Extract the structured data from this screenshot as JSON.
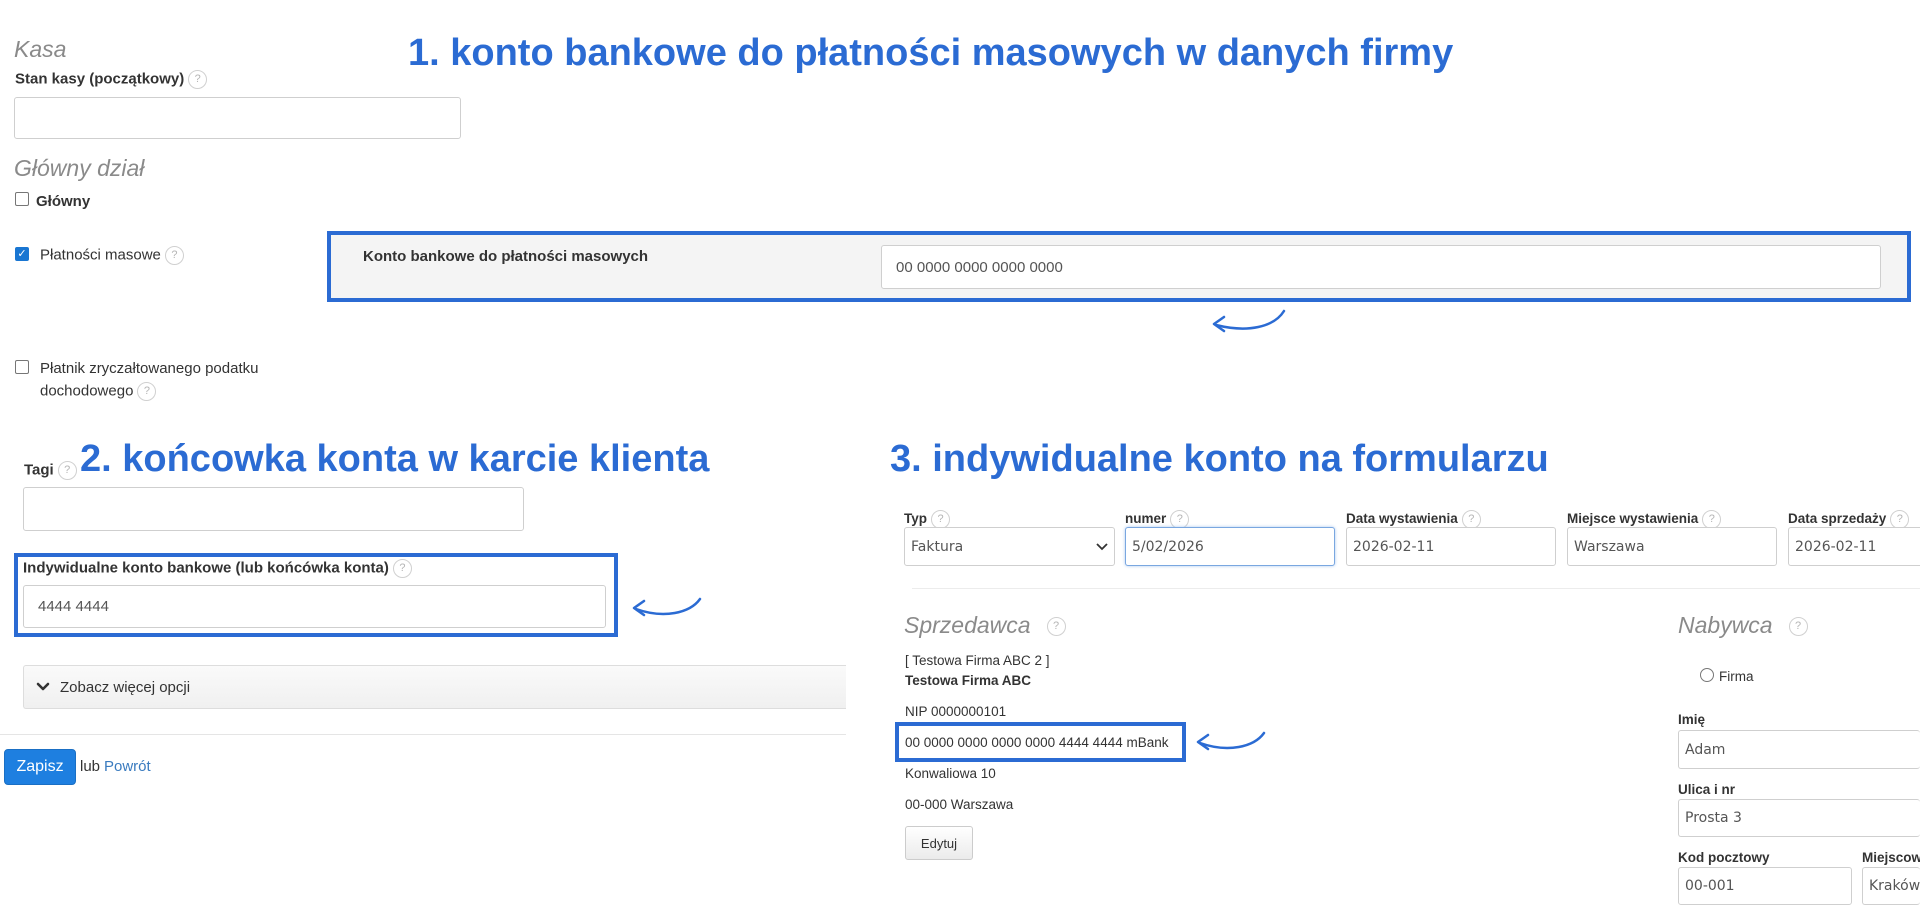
{
  "headings": {
    "h1": "1. konto bankowe do płatności masowych w danych firmy",
    "h2": "2. końcowka konta w karcie klienta",
    "h3": "3. indywidualne konto na formularzu"
  },
  "settings": {
    "kasa_title": "Kasa",
    "stan_kasy_label": "Stan kasy (początkowy)",
    "stan_kasy_value": "",
    "glowny_dzial_title": "Główny dział",
    "glowny_label": "Główny",
    "platnosci_masowe_label": "Płatności masowe",
    "konto_masowe_label": "Konto bankowe do płatności masowych",
    "konto_masowe_value": "00 0000 0000 0000 0000",
    "platnik_line1": "Płatnik zryczałtowanego podatku",
    "platnik_line2": "dochodowego",
    "help_glyph": "?"
  },
  "client": {
    "tagi_label": "Tagi",
    "tagi_value": "",
    "indywidualne_label": "Indywidualne konto bankowe (lub końcówka konta)",
    "indywidualne_value": "4444 4444",
    "more_options": "Zobacz więcej opcji",
    "save_button": "Zapisz",
    "or_text": "lub",
    "back_link": "Powrót"
  },
  "invoice": {
    "typ_label": "Typ",
    "typ_value": "Faktura",
    "numer_label": "numer",
    "numer_value": "5/02/2026",
    "data_wystawienia_label": "Data wystawienia",
    "data_wystawienia_value": "2026-02-11",
    "miejsce_label": "Miejsce wystawienia",
    "miejsce_value": "Warszawa",
    "data_sprzedazy_label": "Data sprzedaży",
    "data_sprzedazy_value": "2026-02-11",
    "sprzedawca_title": "Sprzedawca",
    "seller_short": "[ Testowa Firma ABC 2 ]",
    "seller_name": "Testowa Firma ABC",
    "seller_nip": "NIP 0000000101",
    "seller_account": "00 0000 0000 0000 0000 4444 4444 mBank",
    "seller_street": "Konwaliowa 10",
    "seller_city": "00-000 Warszawa",
    "edit_button": "Edytuj",
    "nabywca_title": "Nabywca",
    "firma_radio": "Firma",
    "imie_label": "Imię",
    "imie_value": "Adam",
    "ulica_label": "Ulica i nr",
    "ulica_value": "Prosta 3",
    "kod_label": "Kod pocztowy",
    "kod_value": "00-001",
    "miejscowosc_label": "Miejscow",
    "miejscowosc_value": "Kraków"
  },
  "colors": {
    "accent": "#2b6bd3",
    "primary_button": "#1e7fe0"
  },
  "icons": {
    "arrow": "curved-arrow-icon",
    "chevron": "chevron-down-icon",
    "check": "checkmark-icon"
  }
}
